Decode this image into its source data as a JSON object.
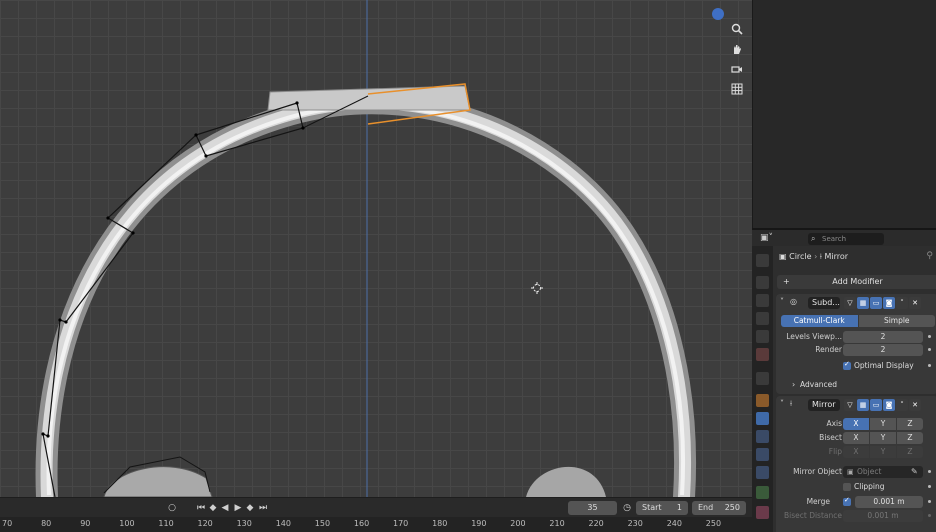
{
  "viewport": {
    "nav_icons": [
      "zoom-icon",
      "hand-pan-icon",
      "camera-icon",
      "grid-icon"
    ]
  },
  "timeline": {
    "current_frame": "35",
    "start_label": "Start",
    "start_value": "1",
    "end_label": "End",
    "end_value": "250",
    "ruler_ticks": [
      "70",
      "80",
      "90",
      "100",
      "110",
      "120",
      "130",
      "140",
      "150",
      "160",
      "170",
      "180",
      "190",
      "200",
      "210",
      "220",
      "230",
      "240",
      "250"
    ]
  },
  "properties": {
    "search_placeholder": "Search",
    "breadcrumb_object": "Circle",
    "breadcrumb_modifier": "Mirror",
    "add_modifier_label": "Add Modifier",
    "subdivision": {
      "name": "Subd...",
      "mode_options": [
        "Catmull-Clark",
        "Simple"
      ],
      "selected_mode": "Catmull-Clark",
      "levels_viewport_label": "Levels Viewp...",
      "levels_viewport_value": "2",
      "render_label": "Render",
      "render_value": "2",
      "optimal_display_label": "Optimal Display",
      "optimal_display_checked": true,
      "advanced_label": "Advanced"
    },
    "mirror": {
      "name": "Mirror",
      "axis_label": "Axis",
      "bisect_label": "Bisect",
      "flip_label": "Flip",
      "axis_letters": [
        "X",
        "Y",
        "Z"
      ],
      "axis_x_enabled": true,
      "mirror_object_label": "Mirror Object",
      "mirror_object_placeholder": "Object",
      "clipping_label": "Clipping",
      "clipping_checked": false,
      "merge_label": "Merge",
      "merge_checked": true,
      "merge_value": "0.001 m",
      "bisect_distance_label": "Bisect Distance",
      "bisect_distance_value": "0.001 m"
    }
  },
  "colors": {
    "accent": "#4772b3",
    "selection_outline": "#e8902c",
    "gizmo_blue": "#3f6fc4"
  }
}
